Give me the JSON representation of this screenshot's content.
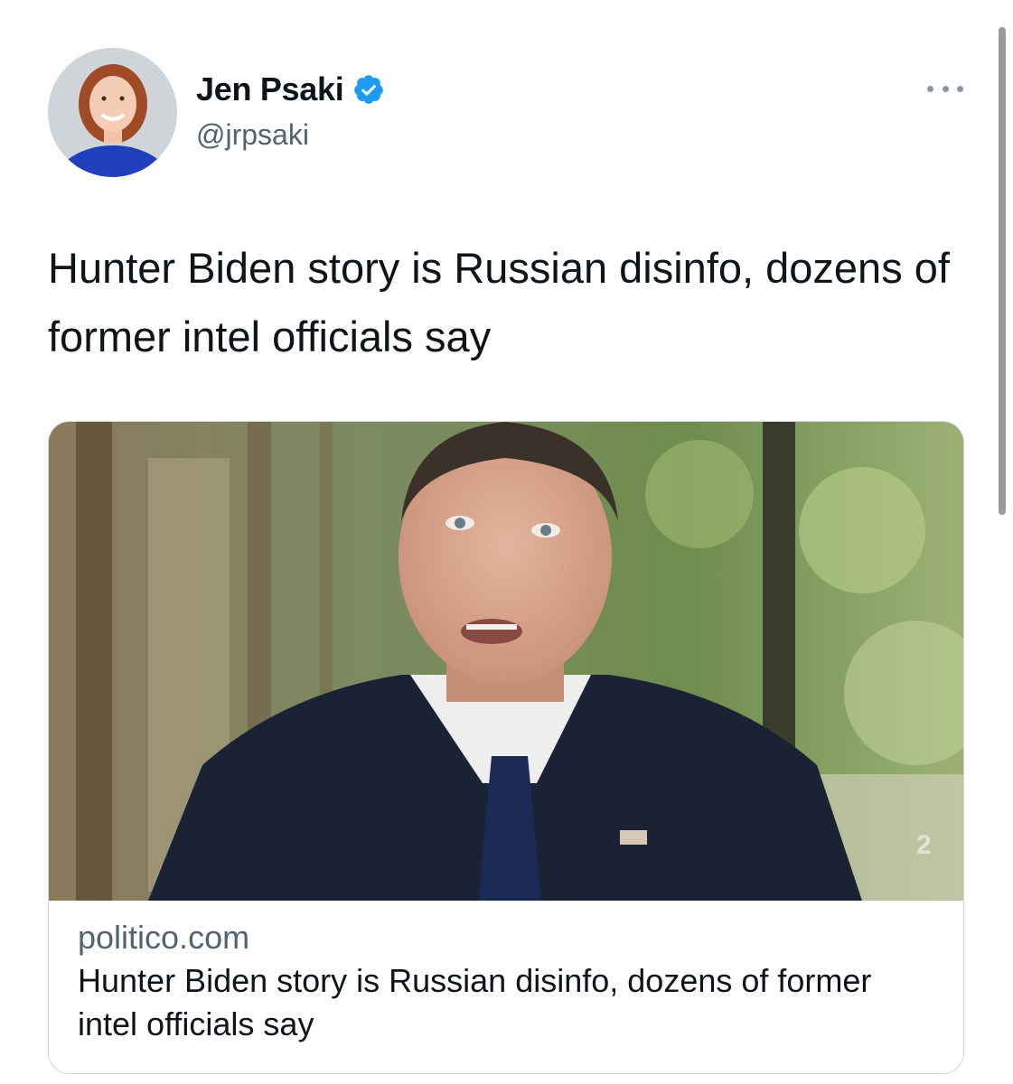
{
  "tweet": {
    "author": {
      "display_name": "Jen Psaki",
      "handle": "@jrpsaki",
      "verified": true
    },
    "text": "Hunter Biden story is Russian disinfo, dozens of former intel officials say",
    "link_card": {
      "domain": "politico.com",
      "title": "Hunter Biden story is Russian disinfo, dozens of former intel officials say"
    }
  },
  "colors": {
    "verified_blue": "#1d9bf0",
    "secondary_text": "#536471",
    "primary_text": "#0f1419",
    "card_border": "#cfd9de"
  },
  "icons": {
    "verified": "verified-badge-icon",
    "more": "more-horizontal-icon"
  }
}
